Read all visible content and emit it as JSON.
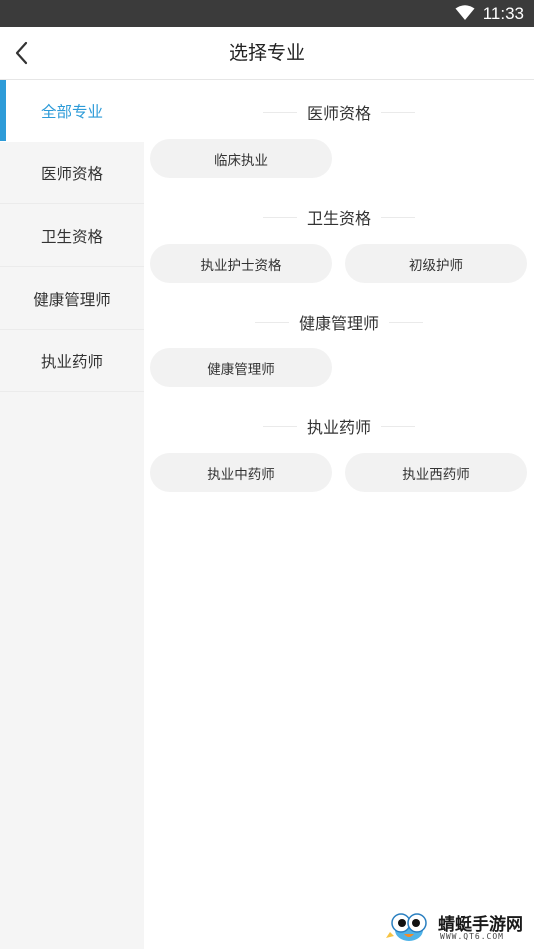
{
  "status_bar": {
    "time": "11:33",
    "wifi_icon": "wifi-icon"
  },
  "header": {
    "back_icon": "chevron-left-icon",
    "title": "选择专业"
  },
  "sidebar": {
    "active_color": "#2d9bd8",
    "items": [
      {
        "label": "全部专业",
        "active": true
      },
      {
        "label": "医师资格",
        "active": false
      },
      {
        "label": "卫生资格",
        "active": false
      },
      {
        "label": "健康管理师",
        "active": false
      },
      {
        "label": "执业药师",
        "active": false
      }
    ]
  },
  "main": {
    "sections": [
      {
        "title": "医师资格",
        "options": [
          "临床执业"
        ]
      },
      {
        "title": "卫生资格",
        "options": [
          "执业护士资格",
          "初级护师"
        ]
      },
      {
        "title": "健康管理师",
        "options": [
          "健康管理师"
        ]
      },
      {
        "title": "执业药师",
        "options": [
          "执业中药师",
          "执业西药师"
        ]
      }
    ]
  },
  "watermark": {
    "name": "蜻蜓手游网",
    "url": "WWW.QT6.COM"
  }
}
